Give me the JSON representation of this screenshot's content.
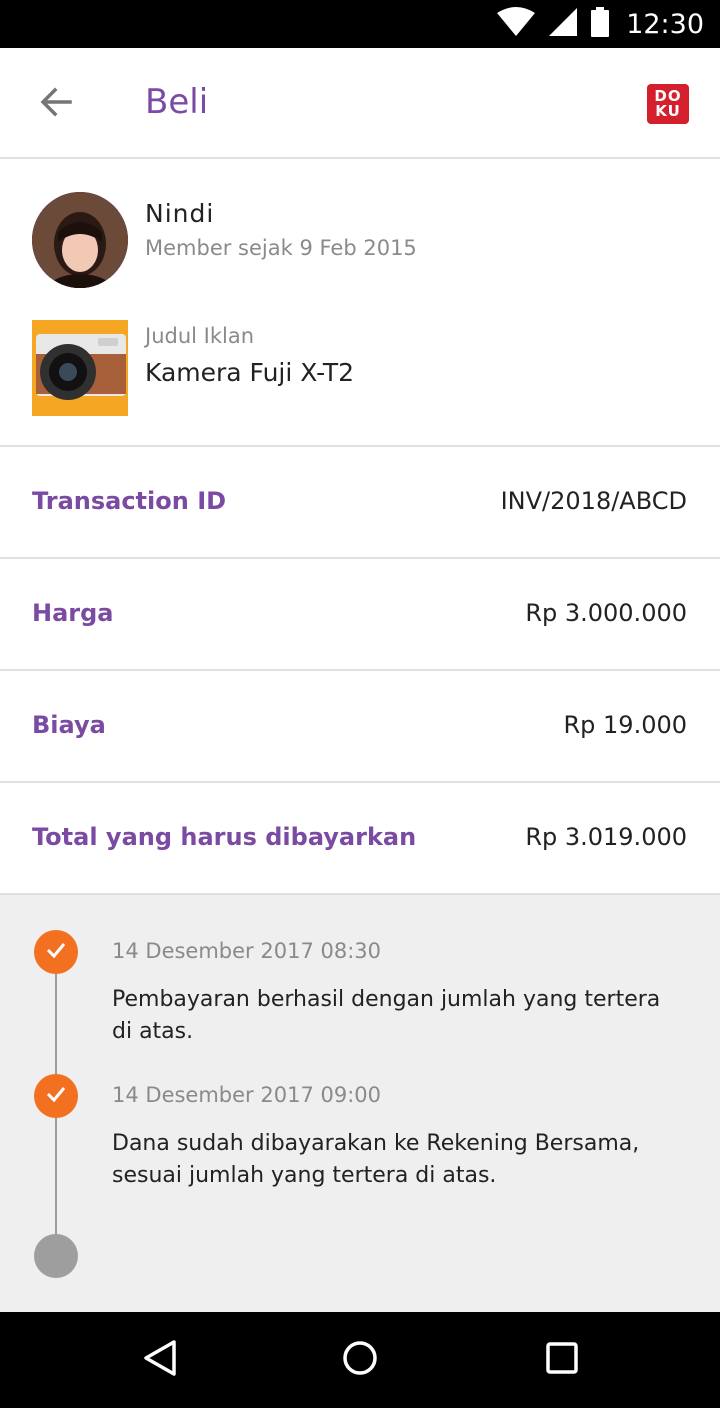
{
  "status_bar": {
    "time": "12:30"
  },
  "app_bar": {
    "title": "Beli",
    "logo_line1": "DO",
    "logo_line2": "KU"
  },
  "seller": {
    "name": "Nindi",
    "member_since": "Member sejak 9 Feb 2015"
  },
  "ad": {
    "label": "Judul Iklan",
    "title": "Kamera Fuji X-T2"
  },
  "details": [
    {
      "label": "Transaction ID",
      "value": "INV/2018/ABCD"
    },
    {
      "label": "Harga",
      "value": "Rp 3.000.000"
    },
    {
      "label": "Biaya",
      "value": "Rp 19.000"
    },
    {
      "label": "Total yang harus dibayarkan",
      "value": "Rp 3.019.000"
    }
  ],
  "timeline": [
    {
      "date": "14 Desember 2017 08:30",
      "text": "Pembayaran berhasil dengan jumlah yang tertera di atas.",
      "status": "done"
    },
    {
      "date": "14 Desember 2017 09:00",
      "text": "Dana sudah dibayarakan ke Rekening Bersama, sesuai jumlah yang tertera di atas.",
      "status": "done"
    },
    {
      "status": "pending"
    }
  ],
  "icons": {
    "wifi": "wifi-icon",
    "signal": "signal-icon",
    "battery": "battery-icon",
    "back": "arrow-back-icon",
    "check": "check-icon",
    "nav_back": "triangle-back-icon",
    "nav_home": "circle-home-icon",
    "nav_recents": "square-recents-icon"
  },
  "colors": {
    "accent": "#7b4aa3",
    "timeline_done": "#f37021",
    "timeline_pending": "#9e9e9e",
    "doku_red": "#d4202c"
  }
}
